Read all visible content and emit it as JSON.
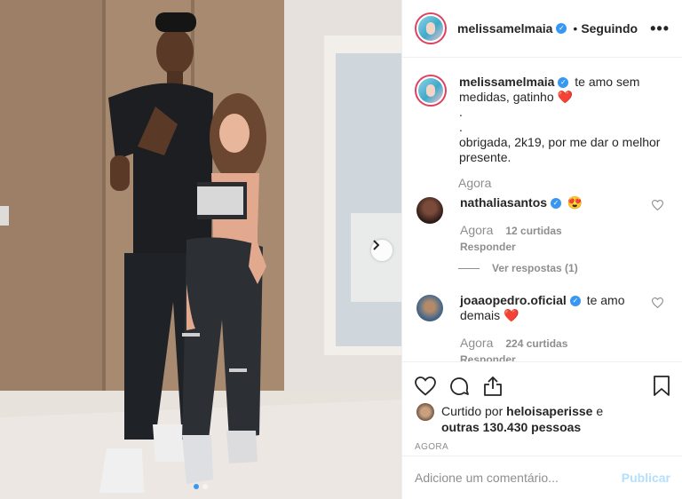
{
  "post": {
    "username": "melissamelmaia",
    "follow_dot": "•",
    "follow_status": "Seguindo",
    "more_icon": "more-horizontal-icon",
    "photo_nav_icon": "chevron-right-icon",
    "carousel": {
      "count": 2,
      "active": 0
    }
  },
  "caption": {
    "username": "melissamelmaia",
    "line1": "te amo sem medidas, gatinho",
    "heart": "❤️",
    "dot1": ".",
    "dot2": ".",
    "line2": "obrigada, 2k19, por me dar o melhor presente.",
    "time": "Agora"
  },
  "comments": [
    {
      "username": "nathaliasantos",
      "text": "",
      "emoji": "😍",
      "time": "Agora",
      "likes": "12 curtidas",
      "reply": "Responder",
      "view_replies": "Ver respostas (1)"
    },
    {
      "username": "joaaopedro.oficial",
      "text": "te amo demais",
      "emoji": "❤️",
      "time": "Agora",
      "likes": "224 curtidas",
      "reply": "Responder"
    }
  ],
  "actions": {
    "liked_prefix": "Curtido por",
    "liked_user": "heloisaperisse",
    "liked_and": "e",
    "liked_others": "outras 130.430 pessoas",
    "timestamp": "AGORA"
  },
  "add_comment": {
    "placeholder": "Adicione um comentário...",
    "publish": "Publicar"
  },
  "colors": {
    "verified": "#3897f0",
    "heart": "#ed4956",
    "publish_disabled": "#b2dffc",
    "muted": "#8e8e8e"
  }
}
